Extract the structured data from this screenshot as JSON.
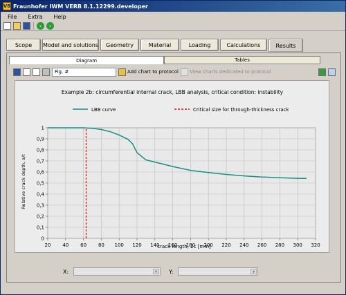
{
  "window": {
    "title": "Fraunhofer IWM VERB 8.1.12299.developer",
    "app_icon_text": "V8"
  },
  "menu": [
    "File",
    "Extra",
    "Help"
  ],
  "main_tabs": [
    "Scope",
    "Model and solutions",
    "Geometry",
    "Material",
    "Loading",
    "Calculations",
    "Results"
  ],
  "sub_tabs": [
    "Diagram",
    "Tables"
  ],
  "chart_toolbar": {
    "figure_input_value": "Fig. #",
    "add_chart_label": "Add chart to protocol",
    "view_charts_label": "View charts dedicated to protocol"
  },
  "axis_selectors": {
    "x_label": "X:",
    "y_label": "Y:"
  },
  "chart_data": {
    "type": "line",
    "title": "Example 2b: circumferential internal crack, LBB analysis, critical condition: instability",
    "xlabel": "crack length, 2c [mm]",
    "ylabel": "Relative crack depth, a/t",
    "xlim": [
      20,
      320
    ],
    "ylim": [
      0,
      1
    ],
    "xticks": [
      "20",
      "40",
      "60",
      "80",
      "100",
      "120",
      "140",
      "160",
      "180",
      "200",
      "220",
      "240",
      "260",
      "280",
      "300",
      "320"
    ],
    "yticks": [
      "0",
      "0,1",
      "0,2",
      "0,3",
      "0,4",
      "0,5",
      "0,6",
      "0,7",
      "0,8",
      "0,9",
      "1"
    ],
    "grid": true,
    "legend_placement": "top-left",
    "series": [
      {
        "name": "LBB curve",
        "color": "#159082",
        "style": "solid",
        "x": [
          20,
          60,
          70,
          80,
          90,
          100,
          110,
          115,
          120,
          130,
          140,
          160,
          180,
          200,
          220,
          240,
          260,
          280,
          300,
          310
        ],
        "y": [
          1.0,
          1.0,
          0.995,
          0.985,
          0.965,
          0.935,
          0.895,
          0.855,
          0.775,
          0.71,
          0.69,
          0.65,
          0.615,
          0.595,
          0.578,
          0.565,
          0.555,
          0.548,
          0.543,
          0.542
        ]
      },
      {
        "name": "Critical size for through-thickness crack",
        "color": "#e0101a",
        "style": "dashed",
        "x": [
          63,
          63
        ],
        "y": [
          0,
          1
        ]
      }
    ]
  }
}
